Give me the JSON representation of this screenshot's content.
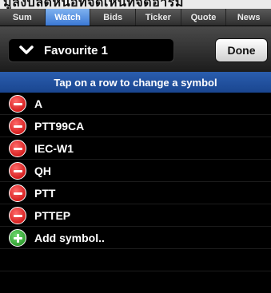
{
  "top_strip_text": "มูลิงบล็ดหนือที่จัดเห็นที่จัดอ่าร่ม",
  "tabs": [
    {
      "label": "Sum",
      "active": false
    },
    {
      "label": "Watch",
      "active": true
    },
    {
      "label": "Bids",
      "active": false
    },
    {
      "label": "Ticker",
      "active": false
    },
    {
      "label": "Quote",
      "active": false
    },
    {
      "label": "News",
      "active": false
    }
  ],
  "toolbar": {
    "favourite_label": "Favourite 1",
    "done_label": "Done"
  },
  "banner": "Tap on a row to change a symbol",
  "symbols": [
    "A",
    "PTT99CA",
    "IEC-W1",
    "QH",
    "PTT",
    "PTTEP"
  ],
  "add_label": "Add symbol..",
  "colors": {
    "accent_tab": "#3b78d4",
    "banner": "#2a5dae",
    "remove": "#c40000",
    "add": "#1a8a1a"
  }
}
